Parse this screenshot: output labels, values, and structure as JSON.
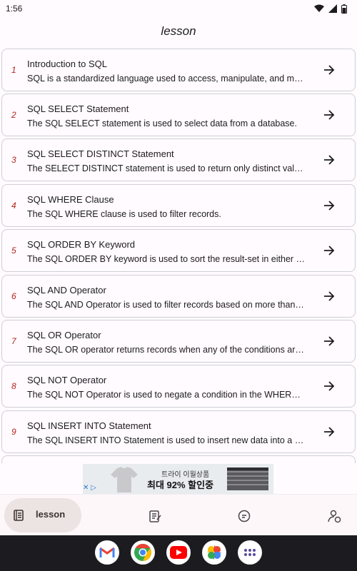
{
  "status_bar": {
    "time": "1:56"
  },
  "app_bar": {
    "title": "lesson"
  },
  "lessons": [
    {
      "num": "1",
      "title": "Introduction to SQL",
      "desc": "SQL is a standardized language used to access, manipulate, and manage databases."
    },
    {
      "num": "2",
      "title": "SQL SELECT Statement",
      "desc": "The SQL SELECT statement is used to select data from a database."
    },
    {
      "num": "3",
      "title": "SQL SELECT DISTINCT Statement",
      "desc": "The SELECT DISTINCT statement is used to return only distinct values."
    },
    {
      "num": "4",
      "title": "SQL WHERE Clause",
      "desc": "The SQL WHERE clause is used to filter records."
    },
    {
      "num": "5",
      "title": "SQL ORDER BY Keyword",
      "desc": "The SQL ORDER BY keyword is used to sort the result-set in either ascending or descending order."
    },
    {
      "num": "6",
      "title": "SQL AND Operator",
      "desc": "The SQL AND Operator is used to filter records based on more than one condition."
    },
    {
      "num": "7",
      "title": "SQL OR Operator",
      "desc": "The SQL OR operator returns records when any of the conditions are true."
    },
    {
      "num": "8",
      "title": "SQL NOT Operator",
      "desc": "The SQL NOT Operator is used to negate a condition in the WHERE clause."
    },
    {
      "num": "9",
      "title": "SQL INSERT INTO Statement",
      "desc": "The SQL INSERT INTO Statement is used to insert new data into a table."
    }
  ],
  "ad": {
    "line1": "트라이 이월상품",
    "line2": "최대 92% 할인중"
  },
  "bottom_nav": {
    "active_label": "lesson"
  },
  "colors": {
    "accent_number": "#b2241e",
    "active_pill": "#ece3e3"
  }
}
